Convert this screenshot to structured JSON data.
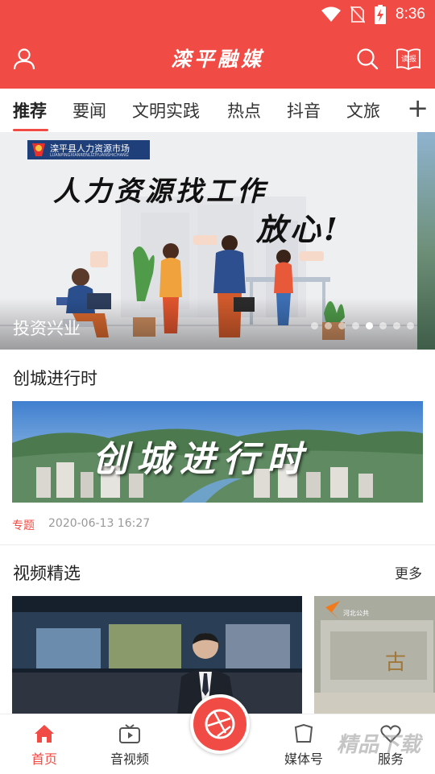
{
  "status_bar": {
    "time": "8:36"
  },
  "header": {
    "title": "滦平融媒",
    "read_icon_label": "读报"
  },
  "tabs": [
    {
      "label": "推荐",
      "active": true
    },
    {
      "label": "要闻"
    },
    {
      "label": "文明实践"
    },
    {
      "label": "热点"
    },
    {
      "label": "抖音"
    },
    {
      "label": "文旅"
    }
  ],
  "banner": {
    "logo_text": "滦平县人力资源市场",
    "logo_subtext": "LUANPINGXIANRENLIZIYUANSHICHANG",
    "headline": "人力资源找工作",
    "headline2": "放心!",
    "caption": "投资兴业",
    "dot_count": 8,
    "active_dot": 5
  },
  "feature_section": {
    "title": "创城进行时",
    "image_text": "创城进行时",
    "tag": "专题",
    "timestamp": "2020-06-13 16:27"
  },
  "video_section": {
    "title": "视频精选",
    "more_label": "更多",
    "thumb2_badge": "河北公共"
  },
  "bottom_nav": [
    {
      "label": "首页",
      "active": true
    },
    {
      "label": "音视频"
    },
    {
      "label": "媒体号"
    },
    {
      "label": "服务"
    }
  ],
  "watermark": "精品下载",
  "colors": {
    "brand": "#f04b44",
    "meta_gray": "#999999"
  }
}
